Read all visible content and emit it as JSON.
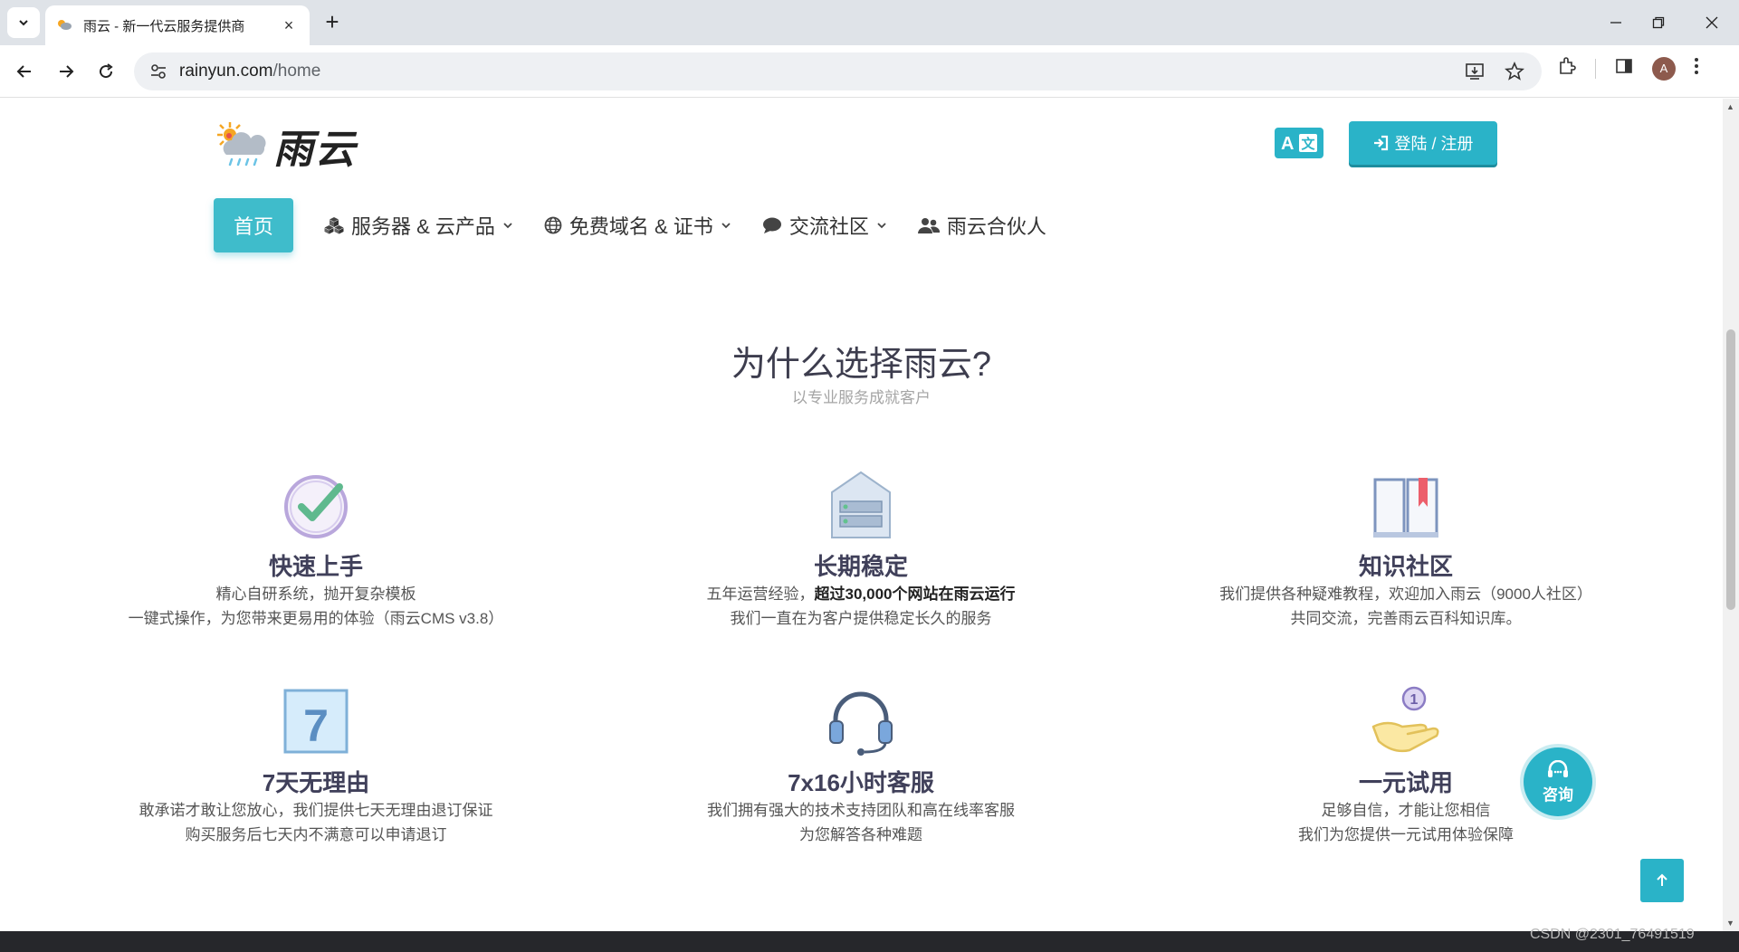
{
  "browser": {
    "tab_title": "雨云 - 新一代云服务提供商",
    "url_domain": "rainyun.com",
    "url_path": "/home",
    "avatar_letter": "A"
  },
  "header": {
    "logo_text": "雨云",
    "lang_label": "A文",
    "login_label": "登陆 / 注册"
  },
  "nav": {
    "home": "首页",
    "items": [
      {
        "label": "服务器 & 云产品",
        "icon": "cubes-icon",
        "has_dropdown": true
      },
      {
        "label": "免费域名 & 证书",
        "icon": "globe-icon",
        "has_dropdown": true
      },
      {
        "label": "交流社区",
        "icon": "comment-icon",
        "has_dropdown": true
      },
      {
        "label": "雨云合伙人",
        "icon": "users-icon",
        "has_dropdown": false
      }
    ]
  },
  "section": {
    "title": "为什么选择雨云?",
    "subtitle": "以专业服务成就客户"
  },
  "features": [
    {
      "title": "快速上手",
      "line1": "精心自研系统，抛开复杂模板",
      "line2": "一键式操作，为您带来更易用的体验（雨云CMS v3.8）",
      "icon": "check-circle-icon"
    },
    {
      "title": "长期稳定",
      "line1_pre": "五年运营经验，",
      "line1_bold": "超过30,000个网站在雨云运行",
      "line2": "我们一直在为客户提供稳定长久的服务",
      "icon": "server-icon"
    },
    {
      "title": "知识社区",
      "line1": "我们提供各种疑难教程，欢迎加入雨云（9000人社区）",
      "line2": "共同交流，完善雨云百科知识库。",
      "icon": "book-icon"
    },
    {
      "title": "7天无理由",
      "line1": "敢承诺才敢让您放心，我们提供七天无理由退订保证",
      "line2": "购买服务后七天内不满意可以申请退订",
      "icon": "calendar-7-icon",
      "icon_text": "7"
    },
    {
      "title": "7x16小时客服",
      "line1": "我们拥有强大的技术支持团队和高在线率客服",
      "line2": "为您解答各种难题",
      "icon": "headset-icon"
    },
    {
      "title": "一元试用",
      "line1": "足够自信，才能让您相信",
      "line2": "我们为您提供一元试用体验保障",
      "icon": "coin-hand-icon",
      "icon_text": "1"
    }
  ],
  "floating": {
    "consult_label": "咨询"
  },
  "watermark": "CSDN @2301_76491519"
}
